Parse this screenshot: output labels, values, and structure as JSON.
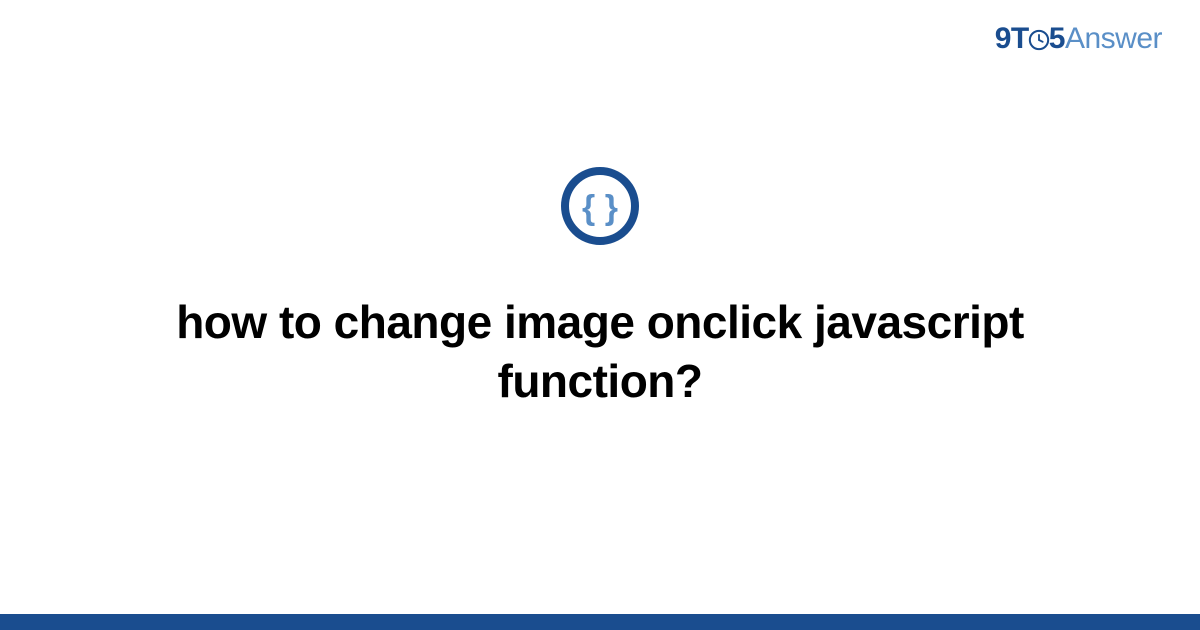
{
  "brand": {
    "prefix": "9T",
    "suffix": "5",
    "word": "Answer"
  },
  "question": {
    "title": "how to change image onclick javascript function?"
  },
  "colors": {
    "brand_dark": "#1a4d8f",
    "brand_light": "#5a8fc7",
    "footer": "#1a4d8f"
  }
}
